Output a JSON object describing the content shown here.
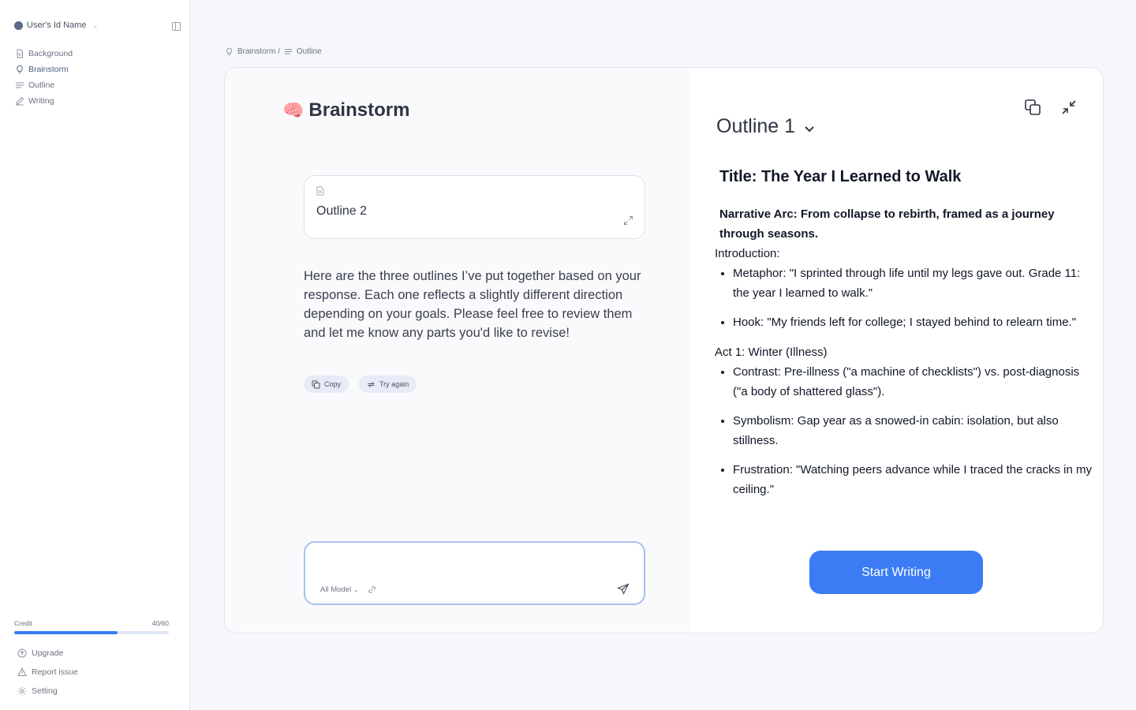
{
  "sidebar": {
    "user_name": "User's Id Name",
    "items": [
      {
        "label": "Background",
        "icon": "document-icon"
      },
      {
        "label": "Brainstorm",
        "icon": "lightbulb-icon"
      },
      {
        "label": "Outline",
        "icon": "list-icon"
      },
      {
        "label": "Writing",
        "icon": "pencil-icon"
      }
    ],
    "active_item": "Brainstorm",
    "credit_label": "Credit",
    "credit_value": "40/60",
    "credit_fraction": 0.67,
    "bottom_items": [
      {
        "label": "Upgrade",
        "icon": "upgrade-icon"
      },
      {
        "label": "Report issue",
        "icon": "warning-icon"
      },
      {
        "label": "Setting",
        "icon": "gear-icon"
      }
    ]
  },
  "breadcrumb": {
    "first": "Brainstorm /",
    "second": "Outline"
  },
  "left": {
    "title": "Brainstorm",
    "title_emoji": "🧠",
    "outline_chip_title": "Outline 2",
    "message": "Here are the three outlines I’ve put together based on your response. Each one reflects a slightly different direction depending on your goals. Please feel free to review them and let me know any parts you'd like to revise!",
    "copy_label": "Copy",
    "try_again_label": "Try again",
    "input_value": "",
    "model_label": "All Model"
  },
  "right": {
    "outline_select": "Outline 1",
    "doc_title": "Title: The Year I Learned to Walk",
    "narrative_arc": "Narrative Arc: From collapse to rebirth, framed as a journey through seasons.",
    "sections": [
      {
        "heading": "Introduction:",
        "bullets": [
          "Metaphor: \"I sprinted through life until my legs gave out. Grade 11: the year I learned to walk.\"",
          "Hook: \"My friends left for college; I stayed behind to relearn time.\""
        ]
      },
      {
        "heading": "Act 1: Winter (Illness)",
        "bullets": [
          "Contrast: Pre-illness (\"a machine of checklists\") vs. post-diagnosis (\"a body of shattered glass\").",
          "Symbolism: Gap year as a snowed-in cabin: isolation, but also stillness.",
          "Frustration: \"Watching peers advance while I traced the cracks in my ceiling.\""
        ]
      }
    ],
    "start_button": "Start Writing"
  },
  "colors": {
    "accent": "#3b7cf5",
    "page_bg": "#f6f7fb",
    "active_nav": "#4b5d7e"
  }
}
